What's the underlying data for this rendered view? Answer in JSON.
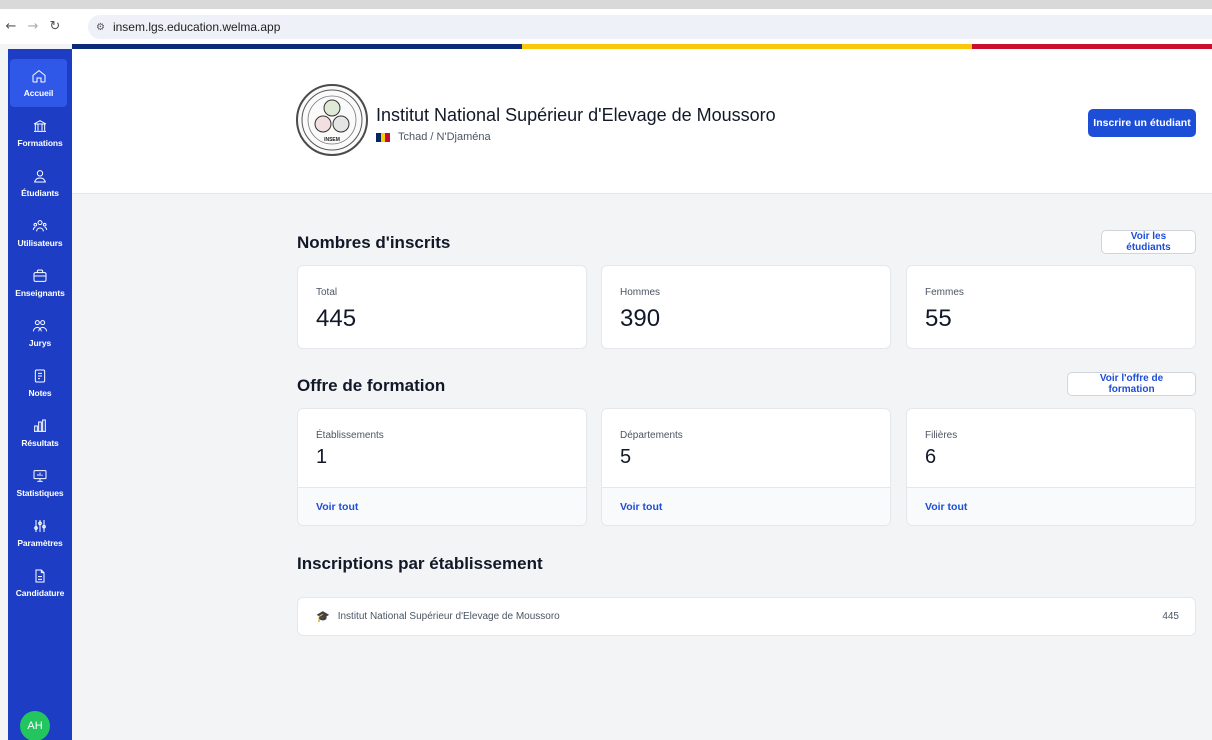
{
  "browser": {
    "url": "insem.lgs.education.welma.app"
  },
  "sidebar": {
    "items": [
      {
        "label": "Accueil",
        "icon": "home-icon"
      },
      {
        "label": "Formations",
        "icon": "building-icon"
      },
      {
        "label": "Étudiants",
        "icon": "user-icon"
      },
      {
        "label": "Utilisateurs",
        "icon": "users-icon"
      },
      {
        "label": "Enseignants",
        "icon": "briefcase-icon"
      },
      {
        "label": "Jurys",
        "icon": "group-icon"
      },
      {
        "label": "Notes",
        "icon": "notes-icon"
      },
      {
        "label": "Résultats",
        "icon": "bar-chart-icon"
      },
      {
        "label": "Statistiques",
        "icon": "presentation-icon"
      },
      {
        "label": "Paramètres",
        "icon": "sliders-icon"
      },
      {
        "label": "Candidature",
        "icon": "document-icon"
      }
    ],
    "avatar": "AH",
    "active_color": "#2f58e8",
    "color": "#1d3ec4"
  },
  "header": {
    "name": "Institut National Supérieur d'Elevage de Moussoro",
    "location": "Tchad / N'Djaména",
    "logo_text": "INSEM",
    "register_button": "Inscrire un étudiant"
  },
  "inscrits": {
    "title": "Nombres d'inscrits",
    "button": "Voir les étudiants",
    "cards": [
      {
        "label": "Total",
        "value": "445"
      },
      {
        "label": "Hommes",
        "value": "390"
      },
      {
        "label": "Femmes",
        "value": "55"
      }
    ]
  },
  "offre": {
    "title": "Offre de formation",
    "button": "Voir l'offre de formation",
    "cards": [
      {
        "label": "Établissements",
        "value": "1",
        "link": "Voir tout"
      },
      {
        "label": "Départements",
        "value": "5",
        "link": "Voir tout"
      },
      {
        "label": "Filières",
        "value": "6",
        "link": "Voir tout"
      }
    ]
  },
  "par_etablissement": {
    "title": "Inscriptions par établissement",
    "rows": [
      {
        "name": "Institut National Supérieur d'Elevage de Moussoro",
        "count": "445",
        "icon": "graduation-cap-icon"
      }
    ]
  }
}
